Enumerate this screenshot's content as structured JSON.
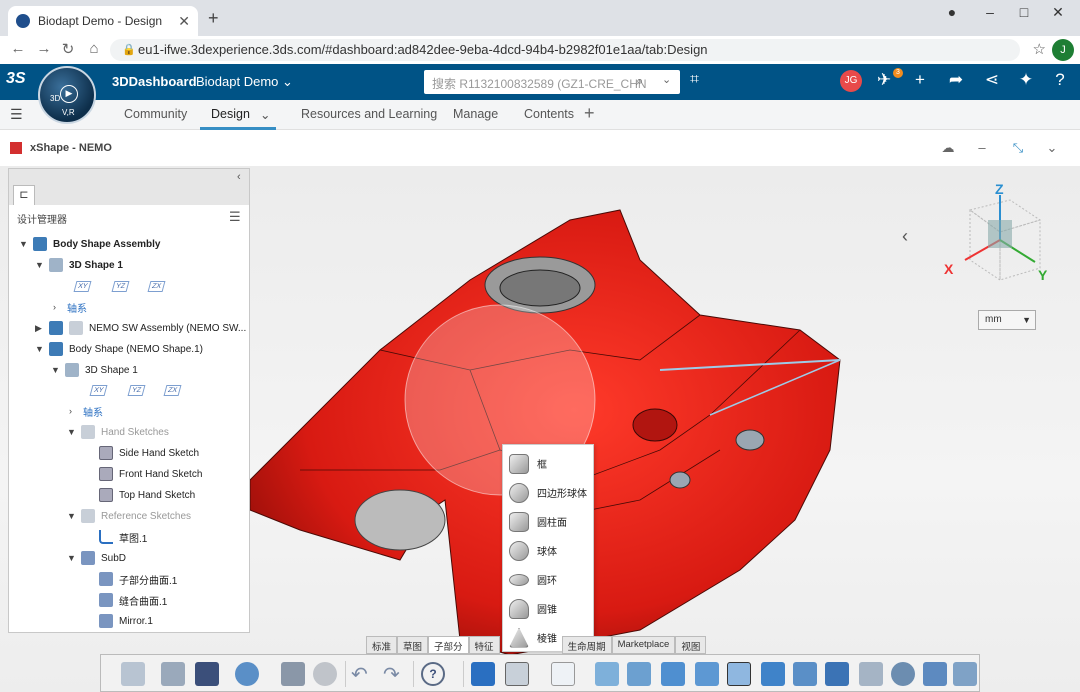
{
  "browser": {
    "tab_title": "Biodapt Demo - Design",
    "new_tab": "+",
    "url": "eu1-ifwe.3dexperience.3ds.com/#dashboard:ad842dee-9eba-4dcd-94b4-b2982f01e1aa/tab:Design",
    "account_initial": "J",
    "window_controls": [
      "–",
      "□",
      "✕"
    ]
  },
  "app": {
    "brand": "3DDashboard",
    "dashboard": "Biodapt Demo",
    "compass_labels": [
      "3D",
      "V,R"
    ],
    "search_placeholder": "搜索 R1132100832589 (GZ1-CRE_CHN",
    "user_initials": "JG",
    "notification_count": "3"
  },
  "nav_tabs": [
    {
      "label": "Community"
    },
    {
      "label": "Design"
    },
    {
      "label": "Resources and Learning"
    },
    {
      "label": "Manage"
    },
    {
      "label": "Contents"
    }
  ],
  "widget": {
    "title": "xShape - NEMO"
  },
  "tree": {
    "header": "设计管理器",
    "items": [
      {
        "label": "Body Shape Assembly"
      },
      {
        "label": "3D Shape 1"
      },
      {
        "label": "轴系"
      },
      {
        "label": "NEMO SW Assembly (NEMO SW..."
      },
      {
        "label": "Body Shape (NEMO Shape.1)"
      },
      {
        "label": "3D Shape 1"
      },
      {
        "label": "轴系"
      },
      {
        "label": "Hand Sketches"
      },
      {
        "label": "Side Hand Sketch"
      },
      {
        "label": "Front Hand Sketch"
      },
      {
        "label": "Top Hand Sketch"
      },
      {
        "label": "Reference Sketches"
      },
      {
        "label": "草图.1"
      },
      {
        "label": "SubD"
      },
      {
        "label": "子部分曲面.1"
      },
      {
        "label": "缝合曲面.1"
      },
      {
        "label": "Mirror.1"
      }
    ],
    "planes": [
      "XY",
      "YZ",
      "ZX"
    ]
  },
  "viewer": {
    "unit": "mm",
    "axes": [
      "Z",
      "X",
      "Y"
    ]
  },
  "popup_menu": {
    "items": [
      {
        "label": "框"
      },
      {
        "label": "四边形球体"
      },
      {
        "label": "圆柱面"
      },
      {
        "label": "球体"
      },
      {
        "label": "圆环"
      },
      {
        "label": "圆锥"
      },
      {
        "label": "棱锥"
      }
    ]
  },
  "bottom_tabs": [
    {
      "label": "标准"
    },
    {
      "label": "草图"
    },
    {
      "label": "子部分"
    },
    {
      "label": "特征"
    },
    {
      "label": "生命周期"
    },
    {
      "label": "Marketplace"
    },
    {
      "label": "视图"
    }
  ],
  "colors": {
    "topbar": "#005386",
    "model_red": "#e8201a",
    "accent_blue": "#368ec4"
  }
}
